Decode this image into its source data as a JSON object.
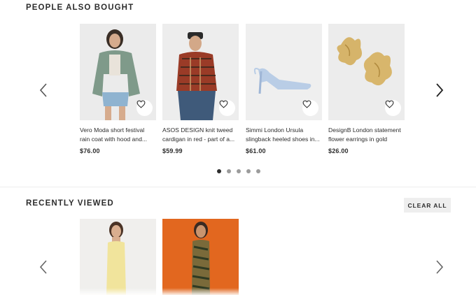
{
  "sections": {
    "people_also_bought": {
      "title": "PEOPLE ALSO BOUGHT"
    },
    "recently_viewed": {
      "title": "RECENTLY VIEWED",
      "clear_label": "CLEAR ALL"
    }
  },
  "products": [
    {
      "name": "Vero Moda short festival rain coat with hood and...",
      "price": "$76.00",
      "image": "model-in-green-jacket"
    },
    {
      "name": "ASOS DESIGN knit tweed cardigan in red - part of a...",
      "price": "$59.99",
      "image": "model-in-red-tweed-cardigan"
    },
    {
      "name": "Simmi London Ursula slingback heeled shoes in...",
      "price": "$61.00",
      "image": "blue-slingback-heel"
    },
    {
      "name": "DesignB London statement flower earrings in gold",
      "price": "$26.00",
      "image": "gold-flower-earrings"
    }
  ],
  "carousel": {
    "page_count": 5,
    "active_page": 1
  },
  "recently_viewed_items": [
    {
      "image": "model-in-yellow-dress"
    },
    {
      "image": "model-in-patterned-dress-orange-background"
    }
  ],
  "icons": {
    "prev": "chevron-left-icon",
    "next": "chevron-right-icon",
    "save": "heart-icon"
  },
  "colors": {
    "text": "#2d2d2d",
    "clear_button_bg": "#eeeeee",
    "dot_active": "#2d2d2d",
    "dot_inactive": "#9b9b9b",
    "rv2_background": "#e2671f"
  }
}
